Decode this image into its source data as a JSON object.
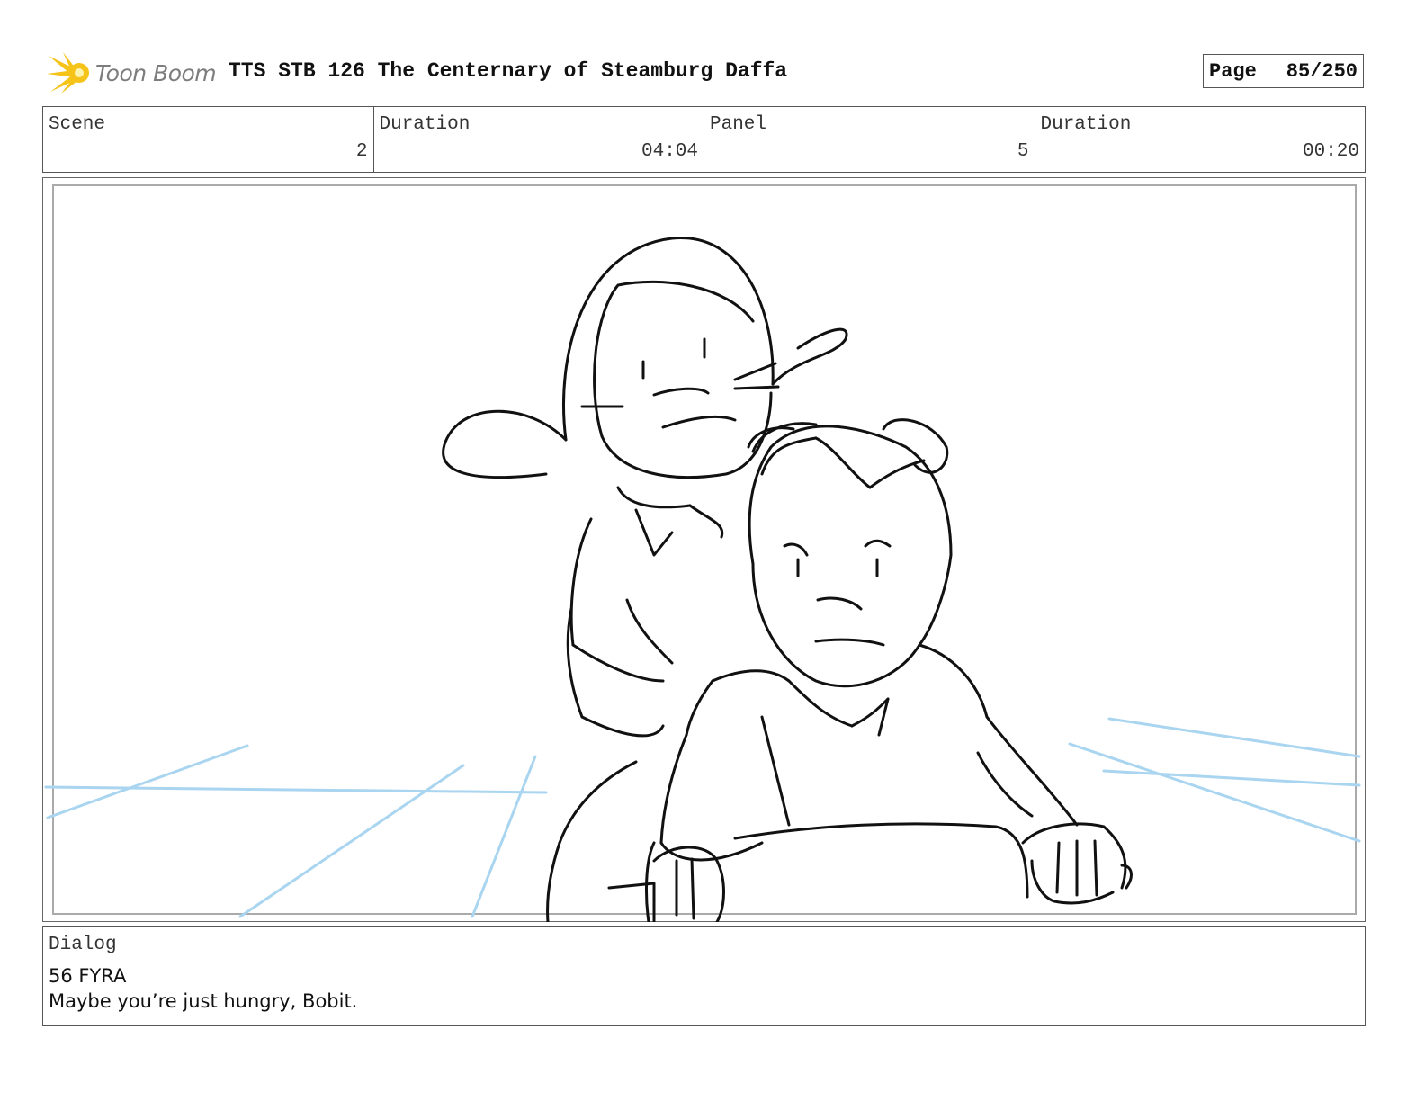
{
  "header": {
    "logo_text": "Toon Boom",
    "title": "TTS STB 126 The Centernary of Steamburg Daffa",
    "page_label": "Page",
    "page_value": "85/250"
  },
  "info": {
    "scene_label": "Scene",
    "scene_value": "2",
    "scene_duration_label": "Duration",
    "scene_duration_value": "04:04",
    "panel_label": "Panel",
    "panel_value": "5",
    "panel_duration_label": "Duration",
    "panel_duration_value": "00:20"
  },
  "dialog": {
    "label": "Dialog",
    "lines": [
      "56 FYRA",
      "Maybe you’re just hungry, Bobit."
    ]
  },
  "colors": {
    "logo_flare": "#f6c319",
    "sketch_lines": "#111111",
    "motion_lines": "#a9d5f0"
  }
}
